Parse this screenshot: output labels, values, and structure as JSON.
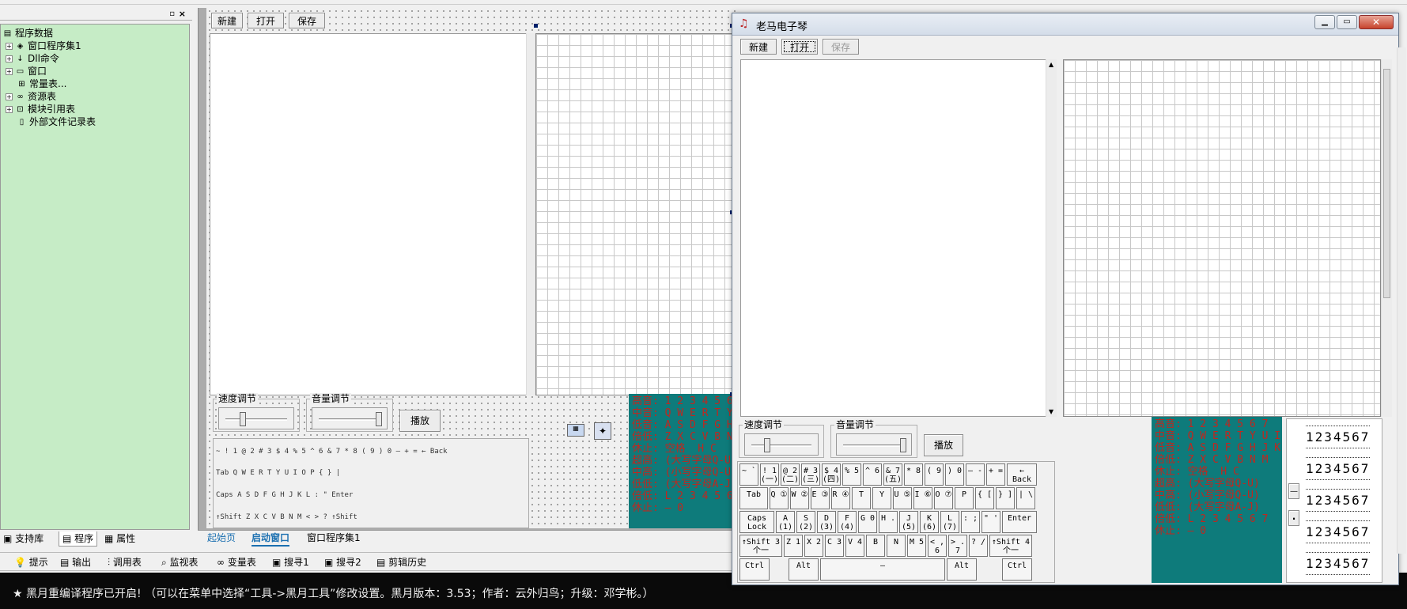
{
  "left_tree": {
    "root": "程序数据",
    "items": [
      "窗口程序集1",
      "Dll命令",
      "窗口",
      "常量表...",
      "资源表",
      "模块引用表",
      "外部文件记录表"
    ]
  },
  "left_tabs": [
    "支持库",
    "程序",
    "属性"
  ],
  "designer": {
    "buttons": [
      "新建",
      "打开",
      "保存"
    ],
    "speed_label": "速度调节",
    "volume_label": "音量调节",
    "play_label": "播放"
  },
  "editor_tabs": [
    "起始页",
    "启动窗口",
    "窗口程序集1"
  ],
  "bottom_tools": [
    "提示",
    "输出",
    "调用表",
    "监视表",
    "变量表",
    "搜寻1",
    "搜寻2",
    "剪辑历史"
  ],
  "status": "★ 黑月重编译程序已开启!  （可以在菜单中选择“工具->黑月工具”修改设置。黑月版本：3.53；作者：云外归鸟；升级：邓学彬。）",
  "app_window": {
    "title": "老马电子琴",
    "buttons": [
      "新建",
      "打开",
      "保存"
    ],
    "speed_label": "速度调节",
    "volume_label": "音量调节",
    "play_label": "播放",
    "minus_label": "—",
    "dot_label": "·"
  },
  "teal_text": {
    "lines": [
      "高音: 1 2 3 4 5 6 7",
      "中音: Q W E R T Y U I O",
      "低音: A S D F G H J K L",
      "倍低: Z X C V B N M",
      "休止: 空格  H C",
      "",
      "超高: (大写字母Q-U)",
      "中高: (小写字母Q-U)",
      "低低: (大写字母A-J)",
      "倍低: L 2 3 4 5 6 7",
      "休止: — 0"
    ]
  },
  "keyboard": {
    "row1": [
      "~ `",
      "! 1 (一)",
      "@ 2 (二)",
      "# 3 (三)",
      "$ 4 (四)",
      "% 5",
      "^ 6",
      "& 7 (五)",
      "* 8",
      "( 9",
      ") 0",
      "— -",
      "+ =",
      "← Back"
    ],
    "row2": [
      "Tab",
      "Q ①",
      "W ②",
      "E ③",
      "R ④",
      "T",
      "Y",
      "U ⑤",
      "I ⑥",
      "O ⑦",
      "P",
      "{ [",
      "} ]",
      "| \\"
    ],
    "row3": [
      "Caps Lock",
      "A (1)",
      "S (2)",
      "D (3)",
      "F (4)",
      "G 0",
      "H .",
      "J (5)",
      "K (6)",
      "L (7)",
      ": ;",
      "\" '",
      "Enter"
    ],
    "row4": [
      "↑Shift 3个一",
      "Z 1",
      "X 2",
      "C 3",
      "V 4",
      "B",
      "N",
      "M 5",
      "< , 6",
      "> . 7",
      "? /",
      "↑Shift 4个一"
    ],
    "row5": [
      "Ctrl",
      "Alt",
      "—",
      "Alt",
      "Ctrl"
    ]
  },
  "notes": {
    "rows": [
      "1234567",
      "1234567",
      "1234567",
      "1234567",
      "1234567"
    ]
  }
}
